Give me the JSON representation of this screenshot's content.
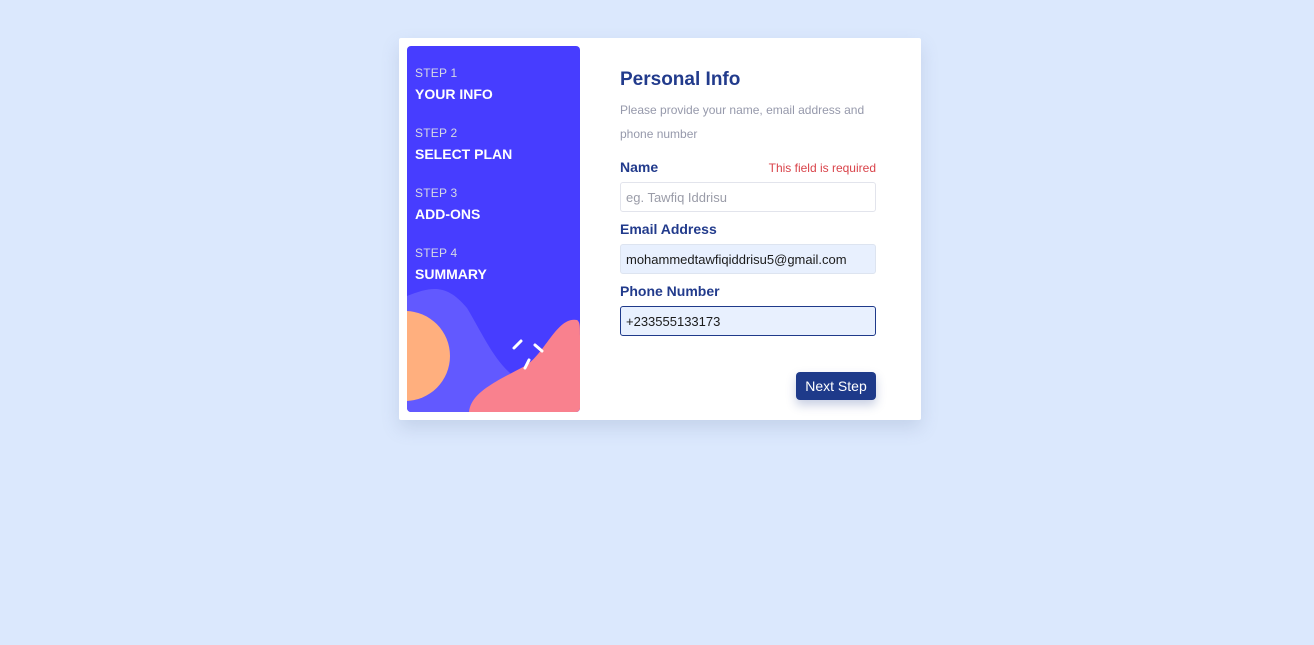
{
  "colors": {
    "page_background": "#dbe8fd",
    "sidebar_background": "#473dff",
    "accent_dark_blue": "#1e3a8a",
    "error_red": "#d9434a",
    "shape_orange": "#ffaf7e",
    "shape_pink": "#f9818e",
    "shape_lavender": "#6259ff"
  },
  "sidebar": {
    "decoration": "sidebar-wave-illustration",
    "steps": [
      {
        "number": "STEP 1",
        "title": "YOUR INFO"
      },
      {
        "number": "STEP 2",
        "title": "SELECT PLAN"
      },
      {
        "number": "STEP 3",
        "title": "ADD-ONS"
      },
      {
        "number": "STEP 4",
        "title": "SUMMARY"
      }
    ]
  },
  "form": {
    "title": "Personal Info",
    "subtitle": "Please provide your name, email address and phone number",
    "fields": {
      "name": {
        "label": "Name",
        "error": "This field is required",
        "value": "",
        "placeholder": "eg. Tawfiq Iddrisu"
      },
      "email": {
        "label": "Email Address",
        "value": "mohammedtawfiqiddrisu5@gmail.com",
        "placeholder": ""
      },
      "phone": {
        "label": "Phone Number",
        "value": "+233555133173",
        "placeholder": ""
      }
    },
    "next_button_label": "Next Step"
  }
}
